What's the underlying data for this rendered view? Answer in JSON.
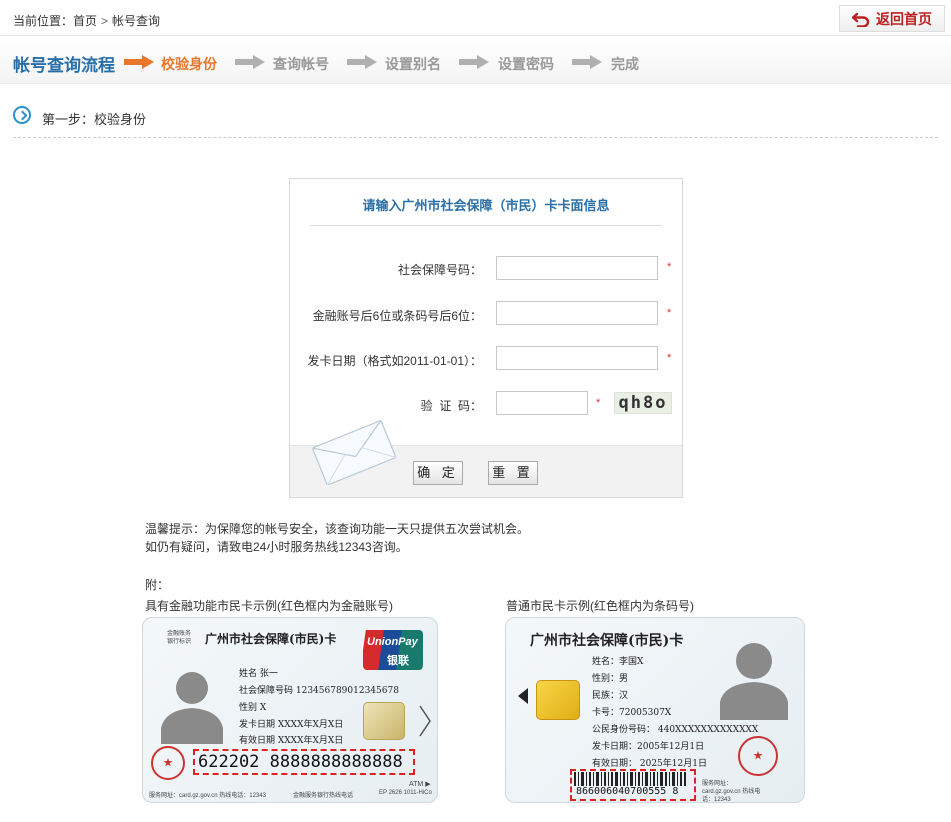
{
  "breadcrumb": {
    "prefix": "当前位置：",
    "home": "首页",
    "separator": ">",
    "current": "帐号查询"
  },
  "home_button": {
    "label": "返回首页",
    "icon": "return-icon"
  },
  "flow": {
    "title": "帐号查询流程",
    "steps": [
      {
        "label": "校验身份",
        "active": true
      },
      {
        "label": "查询帐号",
        "active": false
      },
      {
        "label": "设置别名",
        "active": false
      },
      {
        "label": "设置密码",
        "active": false
      },
      {
        "label": "完成",
        "active": false
      }
    ],
    "colors": {
      "active": "#e8772b",
      "inactive": "#999999"
    }
  },
  "step_header": {
    "label": "第一步：校验身份"
  },
  "form": {
    "title": "请输入广州市社会保障（市民）卡卡面信息",
    "fields": [
      {
        "label": "社会保障号码：",
        "value": "",
        "required": "*"
      },
      {
        "label": "金融账号后6位或条码号后6位：",
        "value": "",
        "required": "*"
      },
      {
        "label": "发卡日期（格式如2011-01-01）：",
        "value": "",
        "required": "*"
      },
      {
        "label": "验  证  码：",
        "value": "",
        "required": "*"
      }
    ],
    "captcha": "qh8o",
    "confirm_label": "确 定",
    "reset_label": "重 置"
  },
  "tips": {
    "line1": "温馨提示：为保障您的帐号安全，该查询功能一天只提供五次尝试机会。",
    "line2": "如仍有疑问，请致电24小时服务热线12343咨询。",
    "appendix": "附："
  },
  "cards": {
    "financial": {
      "caption": "具有金融功能市民卡示例(红色框内为金融账号)",
      "title": "广州市社会保障(市民)卡",
      "corner_text": "金融账务 银行标识",
      "unionpay_en": "UnionPay",
      "unionpay_cn": "银联",
      "rows": [
        "姓名  张一",
        "社会保障号码   123456789012345678",
        "性别  X",
        "发卡日期   XXXX年X月X日",
        "有效日期   XXXX年X月X日"
      ],
      "account": "622202 8888888888888",
      "atm": "ATM ▶",
      "footer_left": "服务网址：card.gz.gov.cn   热线电话：12343",
      "footer_mid": "金融服务银行热线电话",
      "footer_right": "EP 2626 1011-HiCo"
    },
    "regular": {
      "caption": "普通市民卡示例(红色框内为条码号)",
      "title": "广州市社会保障(市民)卡",
      "rows": [
        "姓名：李国X",
        "性别：男",
        "民族：汉",
        "卡号：72005307X",
        "公民身份号码：   440XXXXXXXXXXXXX",
        "发卡日期：2005年12月1日",
        "有效日期：   2025年12月1日"
      ],
      "barcode_number": "866006040700555 8",
      "footer_right": "服务网址：card.gz.gov.cn 热线电话：12343"
    }
  }
}
